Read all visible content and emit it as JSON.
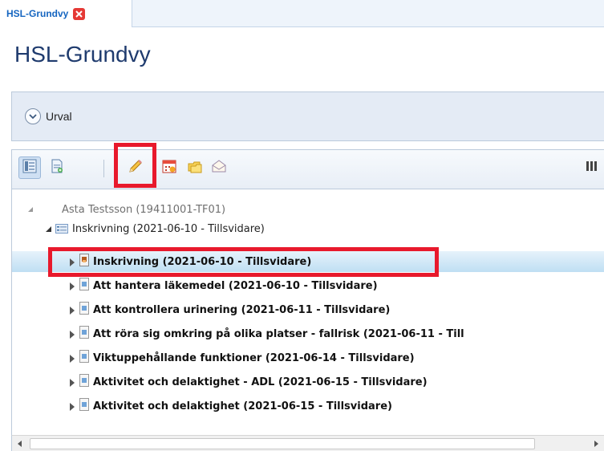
{
  "tab": {
    "title": "HSL-Grundvy"
  },
  "page": {
    "title": "HSL-Grundvy"
  },
  "filter": {
    "urval_label": "Urval"
  },
  "toolbar": {
    "buttons": [
      "list-view-icon",
      "document-view-icon",
      "pencil-edit-icon",
      "calendar-icon",
      "folders-icon",
      "envelope-icon"
    ],
    "columns_icon": "columns-icon"
  },
  "tree": {
    "root": {
      "label": "Asta Testsson (19411001-TF01)"
    },
    "level1": {
      "label": "Inskrivning (2021-06-10 - Tillsvidare)"
    },
    "children": [
      {
        "label": "Inskrivning (2021-06-10 - Tillsvidare)",
        "selected": true
      },
      {
        "label": "Att hantera läkemedel (2021-06-10 - Tillsvidare)"
      },
      {
        "label": "Att kontrollera urinering (2021-06-11 - Tillsvidare)"
      },
      {
        "label": "Att röra sig omkring på olika platser - fallrisk (2021-06-11 - Till"
      },
      {
        "label": "Viktuppehållande funktioner (2021-06-14 - Tillsvidare)"
      },
      {
        "label": "Aktivitet och delaktighet - ADL (2021-06-15 - Tillsvidare)"
      },
      {
        "label": "Aktivitet och delaktighet (2021-06-15 - Tillsvidare)"
      }
    ]
  },
  "colors": {
    "highlight": "#e8192c",
    "title": "#1f3b6e",
    "tab_title": "#1565c0",
    "selected_row": "#bfdff3"
  }
}
